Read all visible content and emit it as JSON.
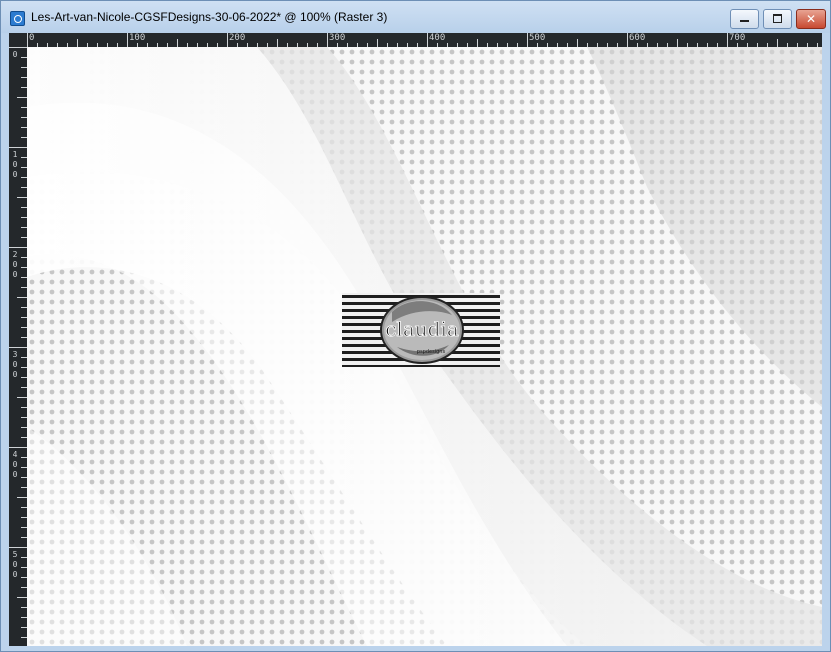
{
  "window": {
    "title": "Les-Art-van-Nicole-CGSFDesigns-30-06-2022* @ 100% (Raster 3)",
    "close_label": "✕"
  },
  "rulers": {
    "horizontal_labels": [
      "0",
      "100",
      "200",
      "300",
      "400",
      "500",
      "600",
      "700"
    ],
    "vertical_labels": [
      "0",
      "100",
      "200",
      "300",
      "400",
      "500"
    ]
  },
  "canvas": {
    "watermark_text": "claudia",
    "watermark_subtext": "pspdesigns"
  }
}
